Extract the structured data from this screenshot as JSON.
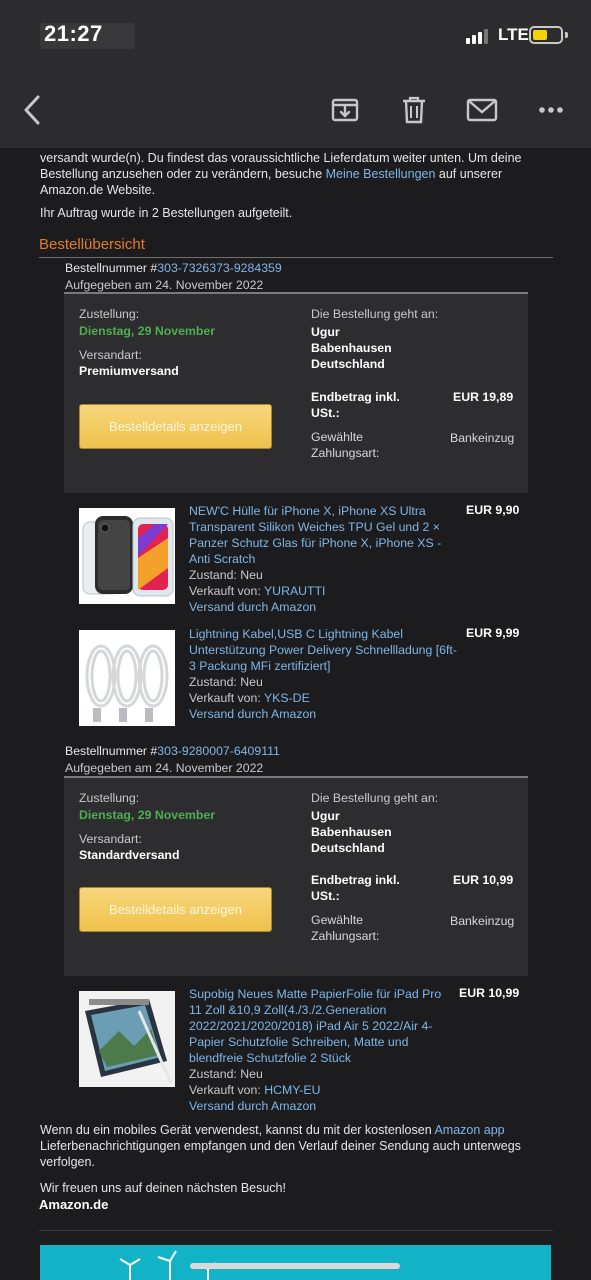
{
  "status": {
    "time": "21:27",
    "network": "LTE"
  },
  "toolbar": {
    "back": "back-icon",
    "archive": "archive-icon",
    "delete": "trash-icon",
    "mail": "mail-icon",
    "more": "more-icon"
  },
  "intro": {
    "line1": "versandt wurde(n). Du findest das voraussichtliche Lieferdatum weiter unten. Um deine",
    "line2a": "Bestellung anzusehen oder zu verändern, besuche ",
    "line2_link": "Meine Bestellungen",
    "line2b": " auf unserer",
    "line3": "Amazon.de Website.",
    "split_note": "Ihr Auftrag wurde in 2 Bestellungen aufgeteilt."
  },
  "overview_title": "Bestellübersicht",
  "orders": [
    {
      "number_label": "Bestellnummer #",
      "number": "303-7326373-9284359",
      "placed": "Aufgegeben am 24. November 2022",
      "delivery_label": "Zustellung:",
      "delivery_date": "Dienstag, 29 November",
      "shipping_label": "Versandart:",
      "shipping_type": "Premiumversand",
      "ship_to_label": "Die Bestellung geht an:",
      "ship_to": [
        "Ugur",
        "Babenhausen",
        "Deutschland"
      ],
      "total_label_1": "Endbetrag inkl.",
      "total_label_2": "USt.:",
      "total": "EUR 19,89",
      "payment_label_1": "Gewählte",
      "payment_label_2": "Zahlungsart:",
      "payment": "Bankeinzug",
      "button": "Bestelldetails anzeigen",
      "items": [
        {
          "title": [
            "NEW'C Hülle für iPhone X, iPhone XS Ultra",
            "Transparent Silikon Weiches TPU Gel und 2 ×",
            "Panzer Schutz Glas für iPhone X, iPhone XS -",
            "Anti Scratch"
          ],
          "condition": "Zustand: Neu",
          "seller_label": "Verkauft von: ",
          "seller": "YURAUTTI",
          "shipping": "Versand durch Amazon",
          "price": "EUR 9,90"
        },
        {
          "title": [
            "Lightning Kabel,USB C Lightning Kabel",
            "Unterstützung Power Delivery Schnellladung [6ft-",
            "3 Packung MFi zertifiziert]"
          ],
          "condition": "Zustand: Neu",
          "seller_label": "Verkauft von: ",
          "seller": "YKS-DE",
          "shipping": "Versand durch Amazon",
          "price": "EUR 9,99"
        }
      ]
    },
    {
      "number_label": "Bestellnummer #",
      "number": "303-9280007-6409111",
      "placed": "Aufgegeben am 24. November 2022",
      "delivery_label": "Zustellung:",
      "delivery_date": "Dienstag, 29 November",
      "shipping_label": "Versandart:",
      "shipping_type": "Standardversand",
      "ship_to_label": "Die Bestellung geht an:",
      "ship_to": [
        "Ugur",
        "Babenhausen",
        "Deutschland"
      ],
      "total_label_1": "Endbetrag inkl.",
      "total_label_2": "USt.:",
      "total": "EUR 10,99",
      "payment_label_1": "Gewählte",
      "payment_label_2": "Zahlungsart:",
      "payment": "Bankeinzug",
      "button": "Bestelldetails anzeigen",
      "items": [
        {
          "title": [
            "Supobig Neues Matte PapierFolie für iPad Pro",
            "11 Zoll &10,9 Zoll(4./3./2.Generation",
            "2022/2021/2020/2018) iPad Air 5 2022/Air 4-",
            "Papier Schutzfolie Schreiben, Matte und",
            "blendfreie Schutzfolie 2 Stück"
          ],
          "condition": "Zustand: Neu",
          "seller_label": "Verkauft von: ",
          "seller": "HCMY-EU",
          "shipping": "Versand durch Amazon",
          "price": "EUR 10,99"
        }
      ]
    }
  ],
  "footer": {
    "app_a": "Wenn du ein mobiles Gerät verwendest, kannst du mit der kostenlosen ",
    "app_link": "Amazon app",
    "app_b": "Lieferbenachrichtigungen empfangen und den Verlauf deiner Sendung auch unterwegs",
    "app_c": "verfolgen.",
    "thanks": "Wir freuen uns auf deinen nächsten Besuch!",
    "brand": "Amazon.de"
  },
  "colors": {
    "accent_orange": "#e07c2a",
    "link": "#7fb6e8",
    "green": "#4caf50",
    "button": "#f0c14b"
  }
}
